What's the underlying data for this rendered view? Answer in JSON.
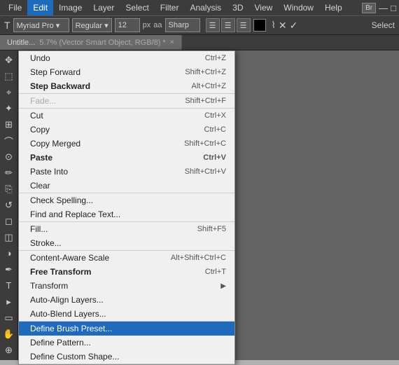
{
  "menubar": {
    "items": [
      {
        "label": "File",
        "active": false
      },
      {
        "label": "Edit",
        "active": true
      },
      {
        "label": "Image",
        "active": false
      },
      {
        "label": "Layer",
        "active": false
      },
      {
        "label": "Select",
        "active": false
      },
      {
        "label": "Filter",
        "active": false
      },
      {
        "label": "Analysis",
        "active": false
      },
      {
        "label": "3D",
        "active": false
      },
      {
        "label": "View",
        "active": false
      },
      {
        "label": "Window",
        "active": false
      },
      {
        "label": "Help",
        "active": false
      }
    ],
    "br_badge": "Br"
  },
  "toolbar": {
    "px_label": "px",
    "sharp_label": "Sharp",
    "align_buttons": [
      "≡",
      "≡",
      "≡"
    ],
    "select_label": "Select"
  },
  "tab": {
    "label": "Untitle...",
    "detail": "5.7% (Vector Smart Object, RGB/8) *",
    "close": "×"
  },
  "dropdown": {
    "sections": [
      {
        "items": [
          {
            "label": "Undo",
            "shortcut": "Ctrl+Z",
            "disabled": false
          },
          {
            "label": "Step Forward",
            "shortcut": "Shift+Ctrl+Z",
            "disabled": false
          },
          {
            "label": "Step Backward",
            "shortcut": "Alt+Ctrl+Z",
            "disabled": false,
            "bold": true
          }
        ]
      },
      {
        "items": [
          {
            "label": "Fade...",
            "shortcut": "Shift+Ctrl+F",
            "disabled": true
          }
        ]
      },
      {
        "items": [
          {
            "label": "Cut",
            "shortcut": "Ctrl+X",
            "disabled": false
          },
          {
            "label": "Copy",
            "shortcut": "Ctrl+C",
            "disabled": false
          },
          {
            "label": "Copy Merged",
            "shortcut": "Shift+Ctrl+C",
            "disabled": false
          },
          {
            "label": "Paste",
            "shortcut": "Ctrl+V",
            "disabled": false,
            "bold": true
          },
          {
            "label": "Paste Into",
            "shortcut": "Shift+Ctrl+V",
            "disabled": false
          },
          {
            "label": "Clear",
            "shortcut": "",
            "disabled": false
          }
        ]
      },
      {
        "items": [
          {
            "label": "Check Spelling...",
            "shortcut": "",
            "disabled": false
          },
          {
            "label": "Find and Replace Text...",
            "shortcut": "",
            "disabled": false
          }
        ]
      },
      {
        "items": [
          {
            "label": "Fill...",
            "shortcut": "Shift+F5",
            "disabled": false
          },
          {
            "label": "Stroke...",
            "shortcut": "",
            "disabled": false
          }
        ]
      },
      {
        "items": [
          {
            "label": "Content-Aware Scale",
            "shortcut": "Alt+Shift+Ctrl+C",
            "disabled": false
          },
          {
            "label": "Free Transform",
            "shortcut": "Ctrl+T",
            "disabled": false,
            "bold": true
          },
          {
            "label": "Transform",
            "shortcut": "",
            "disabled": false,
            "submenu": true
          },
          {
            "label": "Auto-Align Layers...",
            "shortcut": "",
            "disabled": false
          },
          {
            "label": "Auto-Blend Layers...",
            "shortcut": "",
            "disabled": false
          }
        ]
      },
      {
        "items": [
          {
            "label": "Define Brush Preset...",
            "shortcut": "",
            "disabled": false,
            "highlighted": true
          },
          {
            "label": "Define Pattern...",
            "shortcut": "",
            "disabled": false
          },
          {
            "label": "Define Custom Shape...",
            "shortcut": "",
            "disabled": false
          }
        ]
      }
    ]
  }
}
